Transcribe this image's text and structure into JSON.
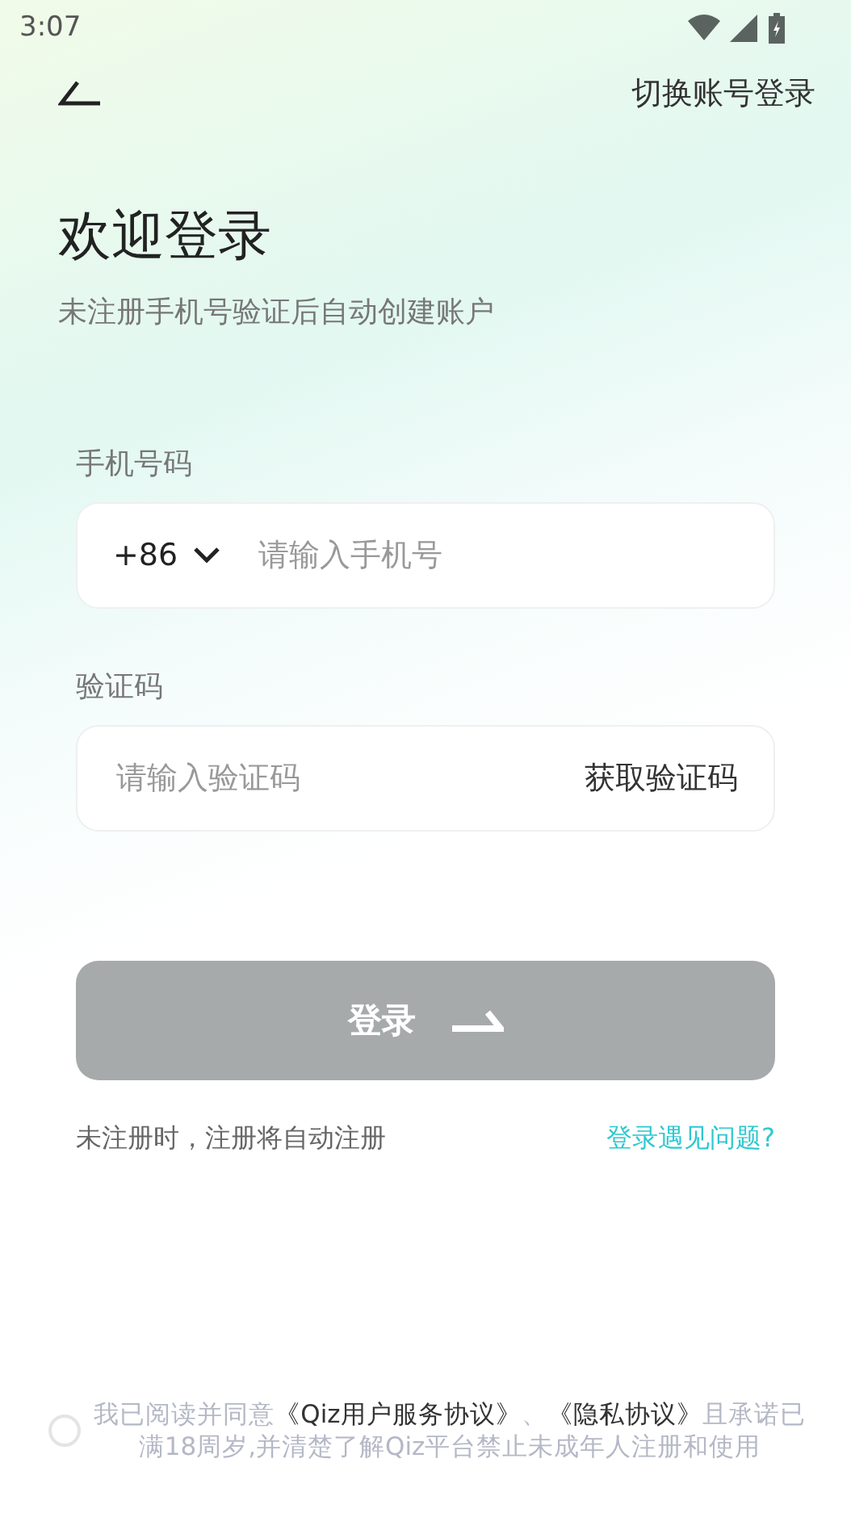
{
  "status_bar": {
    "time": "3:07"
  },
  "header": {
    "switch_account": "切换账号登录"
  },
  "title": "欢迎登录",
  "subtitle": "未注册手机号验证后自动创建账户",
  "phone": {
    "label": "手机号码",
    "country_code": "+86",
    "placeholder": "请输入手机号"
  },
  "code": {
    "label": "验证码",
    "placeholder": "请输入验证码",
    "get_code": "获取验证码"
  },
  "login_button": {
    "label": "登录",
    "disabled": true
  },
  "hint": "未注册时，注册将自动注册",
  "help_link": "登录遇见问题?",
  "agreement": {
    "checked": false,
    "parts": [
      {
        "kind": "plain",
        "text": "我已阅读并同意"
      },
      {
        "kind": "link",
        "text": "《Qiz用户服务协议》"
      },
      {
        "kind": "plain",
        "text": "、"
      },
      {
        "kind": "link",
        "text": "《隐私协议》"
      },
      {
        "kind": "plain",
        "text": "且承诺已满18周岁,并清楚了解Qiz平台禁止未成年人注册和使用"
      }
    ]
  }
}
